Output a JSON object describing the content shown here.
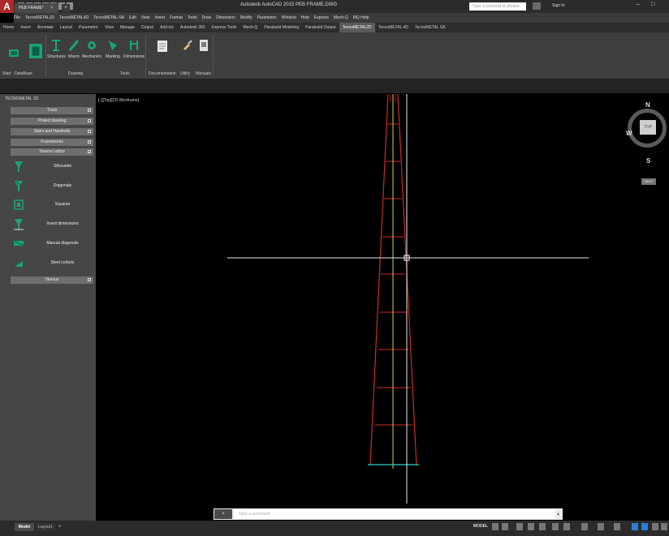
{
  "app": {
    "logo_letter": "A",
    "window_title": "Autodesk AutoCAD 2015   PEB FRAME.DWG",
    "search_placeholder": "Type a keyword or phrase",
    "sign_in": "Sign In",
    "window_buttons": [
      "–",
      "□"
    ]
  },
  "menu": [
    "File",
    "TecnoMETAL2D",
    "TecnoMETAL4D",
    "TecnoMETAL-SA",
    "Edit",
    "View",
    "Insert",
    "Format",
    "Tools",
    "Draw",
    "Dimension",
    "Modify",
    "Parametric",
    "Window",
    "Help",
    "Express",
    "Mech-Q",
    "MQ Help"
  ],
  "ribbon_tabs": {
    "items": [
      "Home",
      "Insert",
      "Annotate",
      "Layout",
      "Parametric",
      "View",
      "Manage",
      "Output",
      "Add-ins",
      "Autodesk 360",
      "Express Tools",
      "Mech-Q",
      "Parabuild Modeling",
      "Parabuild Output",
      "TecnoMETAL2D",
      "TecnoMETAL 4D",
      "TecnoMETAL SA"
    ],
    "active": "TecnoMETAL2D"
  },
  "ribbon": {
    "buttons": {
      "start": "Start",
      "database": "DataBase",
      "structures": "Structures",
      "macro": "Macro",
      "mechanics": "Mechanics",
      "marking": "Marking",
      "dimensions": "Dimensions",
      "documentation": "Documentation",
      "utility": "Utility",
      "manuals": "Manuals"
    },
    "panels": {
      "drawing": "Drawing",
      "tools": "Tools"
    }
  },
  "doc_tab": {
    "name": "PEB FRAME*",
    "close": "×",
    "new_tab": "+"
  },
  "palette": {
    "title": "TECNOMETAL 2D",
    "sections": {
      "trusses": "Truss",
      "project_drawing": "Project drawing",
      "stairs": "Stairs and Handrails",
      "frameworks": "Frameworks",
      "towers": "Towers Lattice",
      "various": "Various"
    },
    "tools": [
      "Silhouette",
      "Diagonals",
      "Squares",
      "Insert dimensions",
      "Manual diagonals",
      "Steel corbels"
    ]
  },
  "viewport": {
    "label": "[–][Top][2D Wireframe]"
  },
  "viewcube": {
    "north": "N",
    "south": "S",
    "west": "W",
    "face": "TOP",
    "wcs": "WCS"
  },
  "command_line": {
    "close": "×",
    "placeholder": "Type a command",
    "arrow": "▲"
  },
  "status": {
    "model_tab": "Model",
    "layout_tab": "Layout1",
    "add_tab": "+",
    "model_space": "MODEL"
  },
  "colors": {
    "canvas": "#000000",
    "tower": "#cc2a2a",
    "centerline": "#d6d62a",
    "base": "#2ad2d2",
    "crosshair": "#ffffff",
    "icon_teal": "#1aa37a"
  }
}
